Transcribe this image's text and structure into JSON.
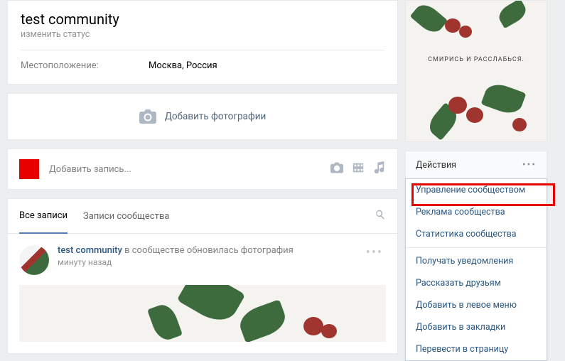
{
  "header": {
    "name": "test community",
    "status_prompt": "изменить статус",
    "location_label": "Местоположение:",
    "location_value": "Москва, Россия"
  },
  "add_photos": {
    "label": "Добавить фотографии"
  },
  "composer": {
    "placeholder": "Добавить запись..."
  },
  "wall": {
    "tabs": {
      "all": "Все записи",
      "community": "Записи сообщества"
    }
  },
  "post": {
    "author": "test community",
    "action": "в сообществе обновилась фотография",
    "time": "минуту назад"
  },
  "cover": {
    "caption": "СМИРИСЬ И РАССЛАБЬСЯ."
  },
  "actions": {
    "title": "Действия",
    "items": {
      "manage": "Управление сообществом",
      "ads": "Реклама сообщества",
      "stats": "Статистика сообщества",
      "notify": "Получать уведомления",
      "tell": "Рассказать друзьям",
      "left_menu": "Добавить в левое меню",
      "bookmark": "Добавить в закладки",
      "transfer": "Перевести в страницу"
    }
  }
}
